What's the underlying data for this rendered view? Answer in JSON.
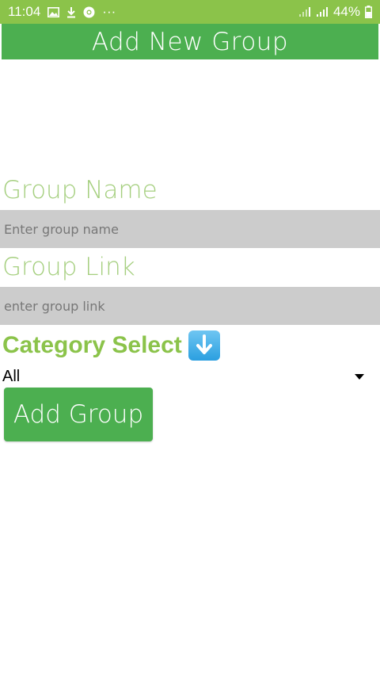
{
  "statusbar": {
    "time": "11:04",
    "battery": "44%",
    "icons": [
      "gallery-icon",
      "download-icon",
      "chrome-icon",
      "more-dots-icon",
      "signal-icon",
      "signal-icon",
      "battery-icon"
    ],
    "more": "···"
  },
  "appbar": {
    "title": "Add New Group"
  },
  "form": {
    "group_name_label": "Group Name",
    "group_name_placeholder": "Enter group name",
    "group_link_label": "Group Link",
    "group_link_placeholder": "enter group link",
    "category_label": "Category Select",
    "category_icon": "down-arrow-emoji-icon",
    "category_selected": "All",
    "submit_label": "Add Group"
  },
  "colors": {
    "statusbar": "#8bc34a",
    "appbar": "#4caf50",
    "label": "#a5cf7f",
    "category_label": "#8bc34a",
    "input_bg": "#cccccc",
    "button": "#4caf50"
  }
}
